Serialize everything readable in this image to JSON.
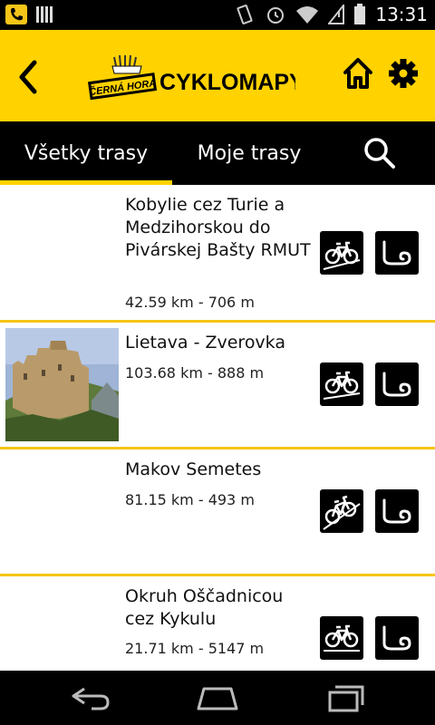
{
  "status_bar": {
    "time": "13:31"
  },
  "header": {
    "logo_brand": "ČERNÁ HORA",
    "logo_site": "CYKLOMAPY.SK"
  },
  "tabs": [
    {
      "label": "Všetky trasy",
      "active": true
    },
    {
      "label": "Moje trasy",
      "active": false
    }
  ],
  "routes": [
    {
      "title": "Kobylie cez Turie a Medzihorskou do Pivárskej Bašty RMUT",
      "meta": "42.59 km - 706 m",
      "has_photo": false
    },
    {
      "title": "Lietava - Zverovka",
      "meta": "103.68 km - 888 m",
      "has_photo": true
    },
    {
      "title": "Makov Semetes",
      "meta": "81.15 km - 493 m",
      "has_photo": false
    },
    {
      "title": "Okruh Oščadnicou cez Kykulu",
      "meta": "21.71 km - 5147 m",
      "has_photo": false
    }
  ],
  "colors": {
    "accent": "#ffd200",
    "bar": "#000000",
    "divider": "#f5c518"
  }
}
